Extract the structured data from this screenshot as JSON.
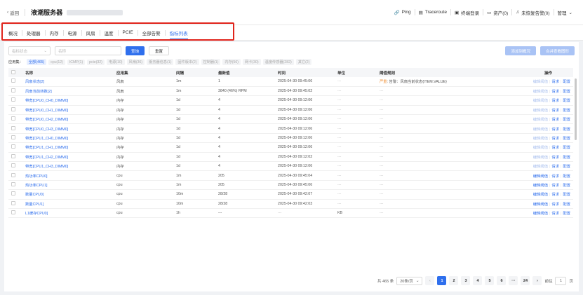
{
  "header": {
    "back_label": "返回",
    "title": "液潮服务器",
    "actions": {
      "ping": "Ping",
      "traceroute": "Traceroute",
      "terminal": "终端登录",
      "assets": "资产(0)",
      "unresolved": "未恢复告警(0)",
      "admin": "管理"
    }
  },
  "tabs": [
    "概况",
    "处理器",
    "内存",
    "电源",
    "风扇",
    "温度",
    "PCIE",
    "全部告警",
    "指标列表"
  ],
  "filters": {
    "status_placeholder": "指标状态",
    "name_placeholder": "名称",
    "query": "查询",
    "reset": "重置",
    "add_overview": "添加到概况",
    "merge_chart": "合并查看图形"
  },
  "appset": {
    "label": "应用集：",
    "chips": [
      "全部(465)",
      "cpu(12)",
      "ICMP(1)",
      "pcie(32)",
      "电源(10)",
      "风扇(36)",
      "服务器信息(1)",
      "固件版本(2)",
      "控制器(1)",
      "内存(56)",
      "网卡(30)",
      "温度传感器(282)",
      "其它(2)"
    ]
  },
  "table": {
    "headers": [
      "名称",
      "应用集",
      "间隔",
      "最新值",
      "时间",
      "单位",
      "阈值规则",
      "操作"
    ],
    "rows": [
      {
        "name": "风扇状态[2]",
        "app": "风扇",
        "interval": "1m",
        "value": "1",
        "time": "2025-04-30 09:45:06",
        "unit": "---",
        "rule_sev": "严重",
        "rule": ": 告警：风扇当前状态{ITEM.VALUE}",
        "op1": "编辑阈值",
        "op1_disabled": true
      },
      {
        "name": "风扇当前转数[2]",
        "app": "风扇",
        "interval": "1m",
        "value": "3840 (46%) RPM",
        "time": "2025-04-30 09:45:02",
        "unit": "---",
        "rule_sev": "",
        "rule": "---",
        "op1": "编辑阈值",
        "op1_disabled": true
      },
      {
        "name": "带宽[CPU0_CH0_DIMM0]",
        "app": "内存",
        "interval": "1d",
        "value": "4",
        "time": "2025-04-30 09:12:06",
        "unit": "---",
        "rule_sev": "",
        "rule": "---",
        "op1": "编辑阈值",
        "op1_disabled": true
      },
      {
        "name": "带宽[CPU0_CH1_DIMM0]",
        "app": "内存",
        "interval": "1d",
        "value": "4",
        "time": "2025-04-30 09:12:06",
        "unit": "---",
        "rule_sev": "",
        "rule": "---",
        "op1": "编辑阈值",
        "op1_disabled": true
      },
      {
        "name": "带宽[CPU0_CH2_DIMM0]",
        "app": "内存",
        "interval": "1d",
        "value": "4",
        "time": "2025-04-30 09:12:06",
        "unit": "---",
        "rule_sev": "",
        "rule": "---",
        "op1": "编辑阈值",
        "op1_disabled": true
      },
      {
        "name": "带宽[CPU0_CH3_DIMM0]",
        "app": "内存",
        "interval": "1d",
        "value": "4",
        "time": "2025-04-30 09:12:06",
        "unit": "---",
        "rule_sev": "",
        "rule": "---",
        "op1": "编辑阈值",
        "op1_disabled": true
      },
      {
        "name": "带宽[CPU1_CH0_DIMM0]",
        "app": "内存",
        "interval": "1d",
        "value": "4",
        "time": "2025-04-30 09:12:06",
        "unit": "---",
        "rule_sev": "",
        "rule": "---",
        "op1": "编辑阈值",
        "op1_disabled": true
      },
      {
        "name": "带宽[CPU1_CH1_DIMM0]",
        "app": "内存",
        "interval": "1d",
        "value": "4",
        "time": "2025-04-30 09:12:06",
        "unit": "---",
        "rule_sev": "",
        "rule": "---",
        "op1": "编辑阈值",
        "op1_disabled": true
      },
      {
        "name": "带宽[CPU1_CH2_DIMM0]",
        "app": "内存",
        "interval": "1d",
        "value": "4",
        "time": "2025-04-30 09:12:02",
        "unit": "---",
        "rule_sev": "",
        "rule": "---",
        "op1": "编辑阈值",
        "op1_disabled": true
      },
      {
        "name": "带宽[CPU1_CH3_DIMM0]",
        "app": "内存",
        "interval": "1d",
        "value": "4",
        "time": "2025-04-30 09:12:06",
        "unit": "---",
        "rule_sev": "",
        "rule": "---",
        "op1": "编辑阈值",
        "op1_disabled": true
      },
      {
        "name": "热功率CPU0]",
        "app": "cpu",
        "interval": "1m",
        "value": "205",
        "time": "2025-04-30 09:45:04",
        "unit": "---",
        "rule_sev": "",
        "rule": "---",
        "op1": "编辑阈值",
        "op1_disabled": false
      },
      {
        "name": "热功率CPU1]",
        "app": "cpu",
        "interval": "1m",
        "value": "205",
        "time": "2025-04-30 09:45:06",
        "unit": "---",
        "rule_sev": "",
        "rule": "---",
        "op1": "编辑阈值",
        "op1_disabled": false
      },
      {
        "name": "数量CPU0]",
        "app": "cpu",
        "interval": "10m",
        "value": "28/28",
        "time": "2025-04-30 09:42:07",
        "unit": "---",
        "rule_sev": "",
        "rule": "---",
        "op1": "编辑阈值",
        "op1_disabled": false
      },
      {
        "name": "数量CPU1]",
        "app": "cpu",
        "interval": "10m",
        "value": "28/28",
        "time": "2025-04-30 09:42:03",
        "unit": "---",
        "rule_sev": "",
        "rule": "---",
        "op1": "编辑阈值",
        "op1_disabled": false
      },
      {
        "name": "L1缓存CPU0]",
        "app": "cpu",
        "interval": "1h",
        "value": "---",
        "time": "---",
        "unit": "KB",
        "rule_sev": "",
        "rule": "---",
        "op1": "编辑阈值",
        "op1_disabled": false
      }
    ],
    "op_request": "请求",
    "op_config": "配置"
  },
  "pager": {
    "total": "共 465 条",
    "page_size": "20条/页",
    "pages": [
      "1",
      "2",
      "3",
      "4",
      "5",
      "6",
      "···",
      "24"
    ],
    "goto": "前往",
    "goto_value": "1",
    "page_unit": "页"
  }
}
